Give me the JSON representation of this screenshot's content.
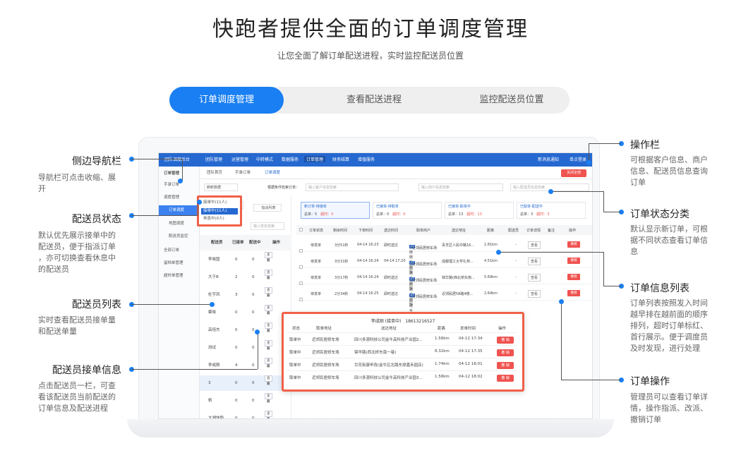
{
  "hero": {
    "title": "快跑者提供全面的订单调度管理",
    "subtitle": "让您全面了解订单配送进程，实时监控配送员位置"
  },
  "tabs": [
    {
      "label": "订单调度管理"
    },
    {
      "label": "查看配送进程"
    },
    {
      "label": "监控配送员位置"
    }
  ],
  "left_annotations": [
    {
      "title": "侧边导航栏",
      "desc": [
        "导航栏可点击收缩、展",
        "开"
      ]
    },
    {
      "title": "配送员状态",
      "desc": [
        "默认优先展示接单中的",
        "配送员，便于指派订单",
        "，亦可切换查看休息中",
        "的配送员"
      ]
    },
    {
      "title": "配送员列表",
      "desc": [
        "实时查看配送员接单量",
        "和配送单量"
      ]
    },
    {
      "title": "配送员接单信息",
      "desc": [
        "点击配送员一栏，可查",
        "看该配送员当前配送的",
        "订单信息及配送进程"
      ]
    }
  ],
  "right_annotations": [
    {
      "title": "操作栏",
      "desc": [
        "可根据客户信息、商户",
        "信息、配送员信息查询",
        "订单"
      ]
    },
    {
      "title": "订单状态分类",
      "desc": [
        "默认显示新订单，可根",
        "据不同状态查看订单信",
        "息"
      ]
    },
    {
      "title": "订单信息列表",
      "desc": [
        "订单列表按照发入时间",
        "越早排在越前面的顺序",
        "排列，超时订单标红、",
        "首行展示。便于调度员",
        "及时发现，进行处理"
      ]
    },
    {
      "title": "订单操作",
      "desc": [
        "管理员可以查看订单详",
        "情，操作指派、改派、",
        "撤销订单"
      ]
    }
  ],
  "app": {
    "brand": "团队调度后台",
    "topnav": [
      "团队管理",
      "运营管理",
      "中转模式",
      "数据服务",
      "订单管理",
      "财务结算",
      "增值服务"
    ],
    "topright": [
      "新消息通知",
      "单点登录"
    ],
    "sidebar": [
      "订单管理",
      "手录订单",
      "调度管理",
      "订单调度",
      "地图调度",
      "配送员监控",
      "全部订单",
      "留档单管理",
      "超时单管理"
    ],
    "pagetabs": [
      "团队首页",
      "手录订单",
      "订单调度"
    ],
    "close_all": "关闭全部",
    "refresh": "刷新数据",
    "search_label": "根据条件检索订单：",
    "search_placeholders": [
      "输入客户信息检索",
      "输入商户信息检索",
      "输入配送员信息检索"
    ],
    "courier_status": "接单中(11人)",
    "courier_options": [
      "接单中(11人)",
      "休息中(0人)"
    ],
    "courier_list_btn": "指派列表",
    "courier_search": "输入姓名检索",
    "courier_headers": [
      "配送员",
      "已接单",
      "配送中",
      "操作"
    ],
    "couriers": [
      {
        "name": "李晓国",
        "accepted": "0",
        "delivering": "0"
      },
      {
        "name": "大于B",
        "accepted": "2",
        "delivering": "0"
      },
      {
        "name": "杜宇风",
        "accepted": "3",
        "delivering": "0"
      },
      {
        "name": "蔡晓",
        "accepted": "0",
        "delivering": "0"
      },
      {
        "name": "高培杰",
        "accepted": "0",
        "delivering": "0"
      },
      {
        "name": "测试",
        "accepted": "0",
        "delivering": "0"
      },
      {
        "name": "李成刚",
        "accepted": "4",
        "delivering": "0"
      },
      {
        "name": "3",
        "accepted": "0",
        "delivering": "0"
      },
      {
        "name": "帆",
        "accepted": "0",
        "delivering": "0"
      },
      {
        "name": "大湖快跑",
        "accepted": "0",
        "delivering": "0"
      }
    ],
    "assign_btn": "指派",
    "view_btn": "查看",
    "status_cards": [
      {
        "title": "新订单-待接单",
        "total": "总单：5",
        "timeout": "超时：5"
      },
      {
        "title": "已接单-待取单",
        "total": "总单：0",
        "timeout": "超时：0"
      },
      {
        "title": "已接单-取单中",
        "total": "总单：13",
        "timeout": "超时：13"
      },
      {
        "title": "已取单-配送中",
        "total": "总单：3",
        "timeout": "超时：3"
      }
    ],
    "order_headers": [
      "订单状态",
      "剩余时间",
      "下单时间",
      "送达时间",
      "取单商户",
      "送达地址",
      "距离",
      "配送员",
      "订单详情",
      "备注",
      "操作"
    ],
    "orders": [
      {
        "status": "待发单",
        "remain": "3分51秒",
        "time": "04-14 16:23",
        "deliver": "即时送达",
        "shop": "小碗碗手抓饭",
        "shop2": "近郊民居修车场",
        "addr": "青羊区人民中路16...",
        "dist": "1.81km"
      },
      {
        "status": "待发单",
        "remain": "3分31秒",
        "time": "04-14 16:24",
        "deliver": "04-14 17:20",
        "shop": "小碗碗手抓饭",
        "shop2": "近郊民居修车场",
        "addr": "成都理工大学礼林...",
        "dist": "4.51km"
      },
      {
        "status": "待发单",
        "remain": "3分17秒",
        "time": "04-14 16:24",
        "deliver": "即时送达",
        "shop": "小碗碗手抓饭",
        "shop2": "近郊民居修车场",
        "addr": "锦华路(西北桥东南...",
        "dist": "5.69km"
      },
      {
        "status": "待发单",
        "remain": "2分34秒",
        "time": "04-14 16:25",
        "deliver": "即时送达",
        "shop": "小碗碗手抓饭",
        "shop2": "近郊民居修车场",
        "addr": "近郊民居58路4楼...",
        "dist": "2.64km"
      }
    ],
    "order_detail_btn": "查看",
    "order_cancel_btn": "撤销"
  },
  "popup": {
    "header": "李成刚 (接单中)　18613216527",
    "headers": [
      "状态",
      "取单地址",
      "送达地址",
      "距离",
      "发单时间",
      "操作"
    ],
    "rows": [
      {
        "status": "取单中",
        "pick": "近郊民居修车场",
        "drop": "四川多源科技公司金牛高科技产业园2...",
        "dist": "1.58km",
        "time": "04-12 17:34",
        "op": "撤 销"
      },
      {
        "status": "取单中",
        "pick": "近郊民居修车场",
        "drop": "锦华路(西北桥东南一巷)",
        "dist": "8.32km",
        "time": "04-12 17:35",
        "op": "撤 销"
      },
      {
        "status": "取单中",
        "pick": "近郊民居修车场",
        "drop": "廿花街康甲改(金牛区北路东原嘉禾园店)",
        "dist": "1.74km",
        "time": "04-12 18:01",
        "op": "撤 销"
      },
      {
        "status": "取单中",
        "pick": "近郊民居修车场",
        "drop": "四川多源科技公司金牛高科技产业园3...",
        "dist": "1.58km",
        "time": "04-12 18:02",
        "op": "撤 销"
      }
    ]
  },
  "colors": {
    "accent": "#1a7ff2",
    "highlight": "#f06048",
    "danger": "#ef5350",
    "topbar": "#2568d0"
  }
}
